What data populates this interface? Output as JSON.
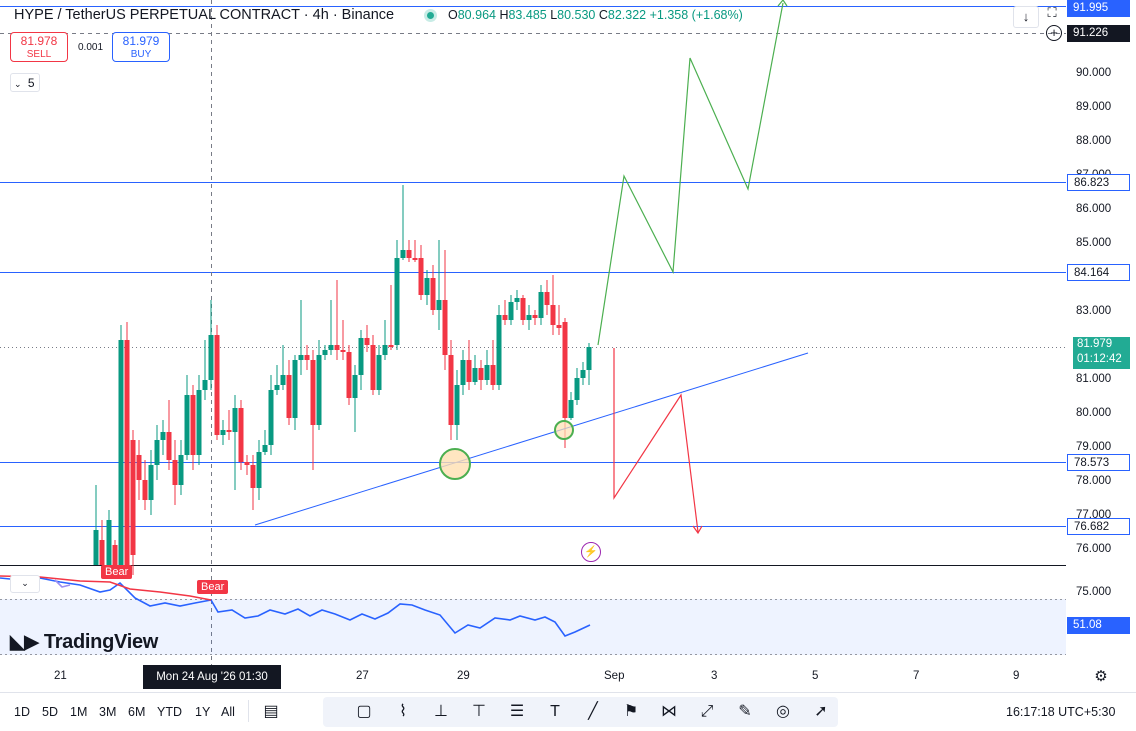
{
  "header": {
    "symbol": "HYPE / TetherUS PERPETUAL CONTRACT · 4h · Binance",
    "ohlc": {
      "o_label": "O",
      "o": "80.964",
      "h_label": "H",
      "h": "83.485",
      "l_label": "L",
      "l": "80.530",
      "c_label": "C",
      "c": "82.322",
      "change": "+1.358 (+1.68%)"
    }
  },
  "trade": {
    "sell_price": "81.978",
    "sell_label": "SELL",
    "spread": "0.001",
    "buy_price": "81.979",
    "buy_label": "BUY"
  },
  "indicator_collapse": {
    "count": "5"
  },
  "price_axis": {
    "labels": [
      "90.000",
      "89.000",
      "88.000",
      "87.000",
      "86.000",
      "85.000",
      "84.000",
      "83.000",
      "82.000",
      "81.000",
      "80.000",
      "79.000",
      "78.000",
      "77.000",
      "76.000",
      "75.000"
    ],
    "tags": {
      "top_line": "91.995",
      "crosshair": "91.226",
      "level1": "86.823",
      "level2": "84.164",
      "last_price": "81.979",
      "countdown": "01:12:42",
      "level3": "78.573",
      "level4": "76.682",
      "rsi_value": "51.08"
    }
  },
  "time_axis": {
    "labels": [
      "21",
      "27",
      "29",
      "Sep",
      "3",
      "5",
      "7",
      "9"
    ],
    "crosshair": "Mon 24 Aug '26   01:30"
  },
  "indicator_labels": {
    "bear1": "Bear",
    "bear2": "Bear"
  },
  "logo": "TradingView",
  "timeframes": [
    "1D",
    "5D",
    "1M",
    "3M",
    "6M",
    "YTD",
    "1Y",
    "All"
  ],
  "clock": "16:17:18 UTC+5:30",
  "colors": {
    "up": "#089981",
    "down": "#f23645",
    "hline": "#2962ff",
    "accent_green": "#22ab94",
    "rsi": "#2962ff"
  },
  "icons": [
    "calendar-range-icon",
    "rectangle-icon",
    "path-icon",
    "long-position-icon",
    "short-position-icon",
    "horizontal-lines-icon",
    "text-icon",
    "trendline-icon",
    "flag-pen-icon",
    "projection-icon",
    "measure-icon",
    "brush-icon",
    "target-icon",
    "arrow-icon"
  ],
  "chart_data": {
    "type": "candlestick",
    "interval": "4h",
    "levels": [
      91.995,
      86.823,
      84.164,
      78.573,
      76.682
    ],
    "last_price": 81.979,
    "ylim": [
      75,
      92
    ],
    "x_ticks": [
      "21",
      "27",
      "29",
      "Sep",
      "3",
      "5",
      "7",
      "9"
    ]
  }
}
